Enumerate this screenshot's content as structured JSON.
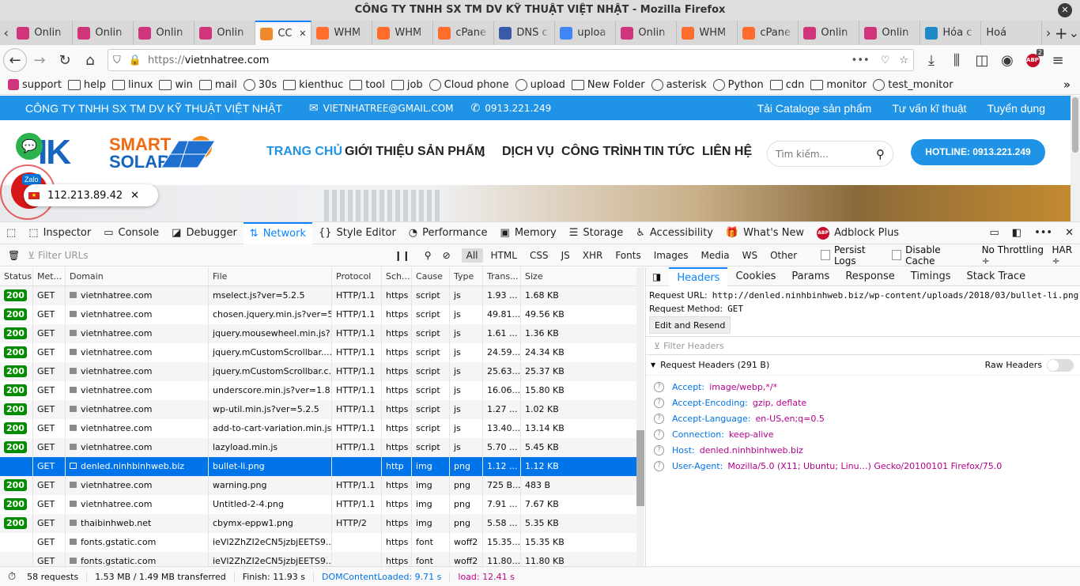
{
  "window": {
    "title": "CÔNG TY TNHH SX TM DV KỸ THUẬT VIỆT NHẬT - Mozilla Firefox"
  },
  "tabs": [
    {
      "label": "Onlin",
      "icon": "online-icon",
      "color": "#d0347a"
    },
    {
      "label": "Onlin",
      "icon": "online-icon",
      "color": "#d0347a"
    },
    {
      "label": "Onlin",
      "icon": "online-icon",
      "color": "#d0347a"
    },
    {
      "label": "Onlin",
      "icon": "online-icon",
      "color": "#d0347a"
    },
    {
      "label": "CC",
      "icon": "shield-icon",
      "color": "#f08b2d",
      "active": true
    },
    {
      "label": "WHM",
      "icon": "cpanel-icon",
      "color": "#ff6c2c"
    },
    {
      "label": "WHM",
      "icon": "cpanel-icon",
      "color": "#ff6c2c"
    },
    {
      "label": "cPane",
      "icon": "cpanel-icon",
      "color": "#ff6c2c"
    },
    {
      "label": "DNS c",
      "icon": "globe-icon",
      "color": "#3a5aa8"
    },
    {
      "label": "uploa",
      "icon": "google-icon",
      "color": "#4285f4"
    },
    {
      "label": "Onlin",
      "icon": "online-icon",
      "color": "#d0347a"
    },
    {
      "label": "WHM",
      "icon": "cpanel-icon",
      "color": "#ff6c2c"
    },
    {
      "label": "cPane",
      "icon": "cpanel-icon",
      "color": "#ff6c2c"
    },
    {
      "label": "Onlin",
      "icon": "online-icon",
      "color": "#d0347a"
    },
    {
      "label": "Onlin",
      "icon": "online-icon",
      "color": "#d0347a"
    },
    {
      "label": "Hóa c",
      "icon": "feather-icon",
      "color": "#1e88c8"
    },
    {
      "label": "Hoá",
      "icon": "",
      "color": "#d8d8d8"
    }
  ],
  "nav": {
    "url_prefix": "https://",
    "url_host": "vietnhatree.com",
    "abp_badge": "2"
  },
  "bookmarks": [
    {
      "label": "support",
      "icon": "online-icon"
    },
    {
      "label": "help",
      "icon": "folder-icon"
    },
    {
      "label": "linux",
      "icon": "folder-icon"
    },
    {
      "label": "win",
      "icon": "folder-icon"
    },
    {
      "label": "mail",
      "icon": "folder-icon"
    },
    {
      "label": "30s",
      "icon": "globe-icon"
    },
    {
      "label": "kienthuc",
      "icon": "folder-icon"
    },
    {
      "label": "tool",
      "icon": "folder-icon"
    },
    {
      "label": "job",
      "icon": "folder-icon"
    },
    {
      "label": "Cloud phone",
      "icon": "cloud-icon"
    },
    {
      "label": "upload",
      "icon": "globe-icon"
    },
    {
      "label": "New Folder",
      "icon": "folder-icon"
    },
    {
      "label": "asterisk",
      "icon": "globe-icon"
    },
    {
      "label": "Python",
      "icon": "globe-icon"
    },
    {
      "label": "cdn",
      "icon": "folder-icon"
    },
    {
      "label": "monitor",
      "icon": "folder-icon"
    },
    {
      "label": "test_monitor",
      "icon": "globe-icon"
    }
  ],
  "site": {
    "company": "CÔNG TY TNHH SX TM DV KỸ THUẬT VIỆT NHẬT",
    "email": "VIETNHATREE@GMAIL.COM",
    "phone": "0913.221.249",
    "top_links": [
      "Tải Cataloge sản phẩm",
      "Tư vấn kĩ thuật",
      "Tuyển dụng"
    ],
    "logo_k": "IK",
    "logo_smart": "SMART",
    "logo_solar": "SOLAR",
    "menu": [
      "TRANG CHỦ",
      "GIỚI THIỆU",
      "SẢN PHẨM",
      "DỊCH VỤ",
      "CÔNG TRÌNH",
      "TIN TỨC",
      "LIÊN HỆ"
    ],
    "search_placeholder": "Tìm kiếm...",
    "hotline": "HOTLINE: 0913.221.249",
    "zalo": "Zalo",
    "ip": "112.213.89.42",
    "partial_phone": "249"
  },
  "devtools": {
    "tools": [
      {
        "label": "Inspector",
        "icon": "inspector-icon",
        "glyph": "⬚"
      },
      {
        "label": "Console",
        "icon": "console-icon",
        "glyph": "▭"
      },
      {
        "label": "Debugger",
        "icon": "debugger-icon",
        "glyph": "◪"
      },
      {
        "label": "Network",
        "icon": "network-icon",
        "glyph": "⇅",
        "active": true
      },
      {
        "label": "Style Editor",
        "icon": "style-editor-icon",
        "glyph": "{}"
      },
      {
        "label": "Performance",
        "icon": "performance-icon",
        "glyph": "◔"
      },
      {
        "label": "Memory",
        "icon": "memory-icon",
        "glyph": "▣"
      },
      {
        "label": "Storage",
        "icon": "storage-icon",
        "glyph": "☰"
      },
      {
        "label": "Accessibility",
        "icon": "accessibility-icon",
        "glyph": "♿"
      },
      {
        "label": "What's New",
        "icon": "gift-icon",
        "glyph": "🎁"
      },
      {
        "label": "Adblock Plus",
        "icon": "abp-icon",
        "glyph": "ABP"
      }
    ],
    "filter_placeholder": "Filter URLs",
    "type_filters": [
      "All",
      "HTML",
      "CSS",
      "JS",
      "XHR",
      "Fonts",
      "Images",
      "Media",
      "WS",
      "Other"
    ],
    "persist_logs": "Persist Logs",
    "disable_cache": "Disable Cache",
    "throttling": "No Throttling ÷",
    "har": "HAR ÷",
    "columns": [
      "Status",
      "Met...",
      "Domain",
      "File",
      "Protocol",
      "Sch...",
      "Cause",
      "Type",
      "Trans...",
      "Size"
    ],
    "rows": [
      {
        "status": "200",
        "method": "GET",
        "domain": "vietnhatree.com",
        "file": "mselect.js?ver=5.2.5",
        "protocol": "HTTP/1.1",
        "scheme": "https",
        "cause": "script",
        "type": "js",
        "transferred": "1.93 ...",
        "size": "1.68 KB"
      },
      {
        "status": "200",
        "method": "GET",
        "domain": "vietnhatree.com",
        "file": "chosen.jquery.min.js?ver=5...",
        "protocol": "HTTP/1.1",
        "scheme": "https",
        "cause": "script",
        "type": "js",
        "transferred": "49.81...",
        "size": "49.56 KB"
      },
      {
        "status": "200",
        "method": "GET",
        "domain": "vietnhatree.com",
        "file": "jquery.mousewheel.min.js?...",
        "protocol": "HTTP/1.1",
        "scheme": "https",
        "cause": "script",
        "type": "js",
        "transferred": "1.61 ...",
        "size": "1.36 KB"
      },
      {
        "status": "200",
        "method": "GET",
        "domain": "vietnhatree.com",
        "file": "jquery.mCustomScrollbar....",
        "protocol": "HTTP/1.1",
        "scheme": "https",
        "cause": "script",
        "type": "js",
        "transferred": "24.59...",
        "size": "24.34 KB"
      },
      {
        "status": "200",
        "method": "GET",
        "domain": "vietnhatree.com",
        "file": "jquery.mCustomScrollbar.c...",
        "protocol": "HTTP/1.1",
        "scheme": "https",
        "cause": "script",
        "type": "js",
        "transferred": "25.63...",
        "size": "25.37 KB"
      },
      {
        "status": "200",
        "method": "GET",
        "domain": "vietnhatree.com",
        "file": "underscore.min.js?ver=1.8.3",
        "protocol": "HTTP/1.1",
        "scheme": "https",
        "cause": "script",
        "type": "js",
        "transferred": "16.06...",
        "size": "15.80 KB"
      },
      {
        "status": "200",
        "method": "GET",
        "domain": "vietnhatree.com",
        "file": "wp-util.min.js?ver=5.2.5",
        "protocol": "HTTP/1.1",
        "scheme": "https",
        "cause": "script",
        "type": "js",
        "transferred": "1.27 ...",
        "size": "1.02 KB"
      },
      {
        "status": "200",
        "method": "GET",
        "domain": "vietnhatree.com",
        "file": "add-to-cart-variation.min.js...",
        "protocol": "HTTP/1.1",
        "scheme": "https",
        "cause": "script",
        "type": "js",
        "transferred": "13.40...",
        "size": "13.14 KB"
      },
      {
        "status": "200",
        "method": "GET",
        "domain": "vietnhatree.com",
        "file": "lazyload.min.js",
        "protocol": "HTTP/1.1",
        "scheme": "https",
        "cause": "script",
        "type": "js",
        "transferred": "5.70 ...",
        "size": "5.45 KB"
      },
      {
        "status": "",
        "method": "GET",
        "domain": "denled.ninhbinhweb.biz",
        "file": "bullet-li.png",
        "protocol": "",
        "scheme": "http",
        "cause": "img",
        "type": "png",
        "transferred": "1.12 ...",
        "size": "1.12 KB",
        "selected": true,
        "insecure": true
      },
      {
        "status": "200",
        "method": "GET",
        "domain": "vietnhatree.com",
        "file": "warning.png",
        "protocol": "HTTP/1.1",
        "scheme": "https",
        "cause": "img",
        "type": "png",
        "transferred": "725 B...",
        "size": "483 B"
      },
      {
        "status": "200",
        "method": "GET",
        "domain": "vietnhatree.com",
        "file": "Untitled-2-4.png",
        "protocol": "HTTP/1.1",
        "scheme": "https",
        "cause": "img",
        "type": "png",
        "transferred": "7.91 ...",
        "size": "7.67 KB"
      },
      {
        "status": "200",
        "method": "GET",
        "domain": "thaibinhweb.net",
        "file": "cbymx-eppw1.png",
        "protocol": "HTTP/2",
        "scheme": "https",
        "cause": "img",
        "type": "png",
        "transferred": "5.58 ...",
        "size": "5.35 KB"
      },
      {
        "status": "",
        "method": "GET",
        "domain": "fonts.gstatic.com",
        "file": "ieVl2ZhZI2eCN5jzbjEETS9...",
        "protocol": "",
        "scheme": "https",
        "cause": "font",
        "type": "woff2",
        "transferred": "15.35...",
        "size": "15.35 KB"
      },
      {
        "status": "",
        "method": "GET",
        "domain": "fonts.gstatic.com",
        "file": "ieVl2ZhZI2eCN5jzbjEETS9...",
        "protocol": "",
        "scheme": "https",
        "cause": "font",
        "type": "woff2",
        "transferred": "11.80...",
        "size": "11.80 KB"
      }
    ],
    "side_tabs": [
      "Headers",
      "Cookies",
      "Params",
      "Response",
      "Timings",
      "Stack Trace"
    ],
    "request_url_label": "Request URL:",
    "request_url": "http://denled.ninhbinhweb.biz/wp-content/uploads/2018/03/bullet-li.png",
    "request_method_label": "Request Method:",
    "request_method": "GET",
    "edit_resend": "Edit and Resend",
    "filter_headers": "Filter Headers",
    "request_headers_title": "Request Headers (291 B)",
    "raw_headers": "Raw Headers",
    "headers": [
      {
        "name": "Accept:",
        "value": "image/webp,*/*"
      },
      {
        "name": "Accept-Encoding:",
        "value": "gzip, deflate"
      },
      {
        "name": "Accept-Language:",
        "value": "en-US,en;q=0.5"
      },
      {
        "name": "Connection:",
        "value": "keep-alive"
      },
      {
        "name": "Host:",
        "value": "denled.ninhbinhweb.biz"
      },
      {
        "name": "User-Agent:",
        "value": "Mozilla/5.0 (X11; Ubuntu; Linu…) Gecko/20100101 Firefox/75.0"
      }
    ],
    "status": {
      "requests": "58 requests",
      "transferred": "1.53 MB / 1.49 MB transferred",
      "finish": "Finish: 11.93 s",
      "dcl": "DOMContentLoaded: 9.71 s",
      "load": "load: 12.41 s",
      "dcl_color": "#0074e8",
      "load_color": "#c8008a"
    }
  }
}
